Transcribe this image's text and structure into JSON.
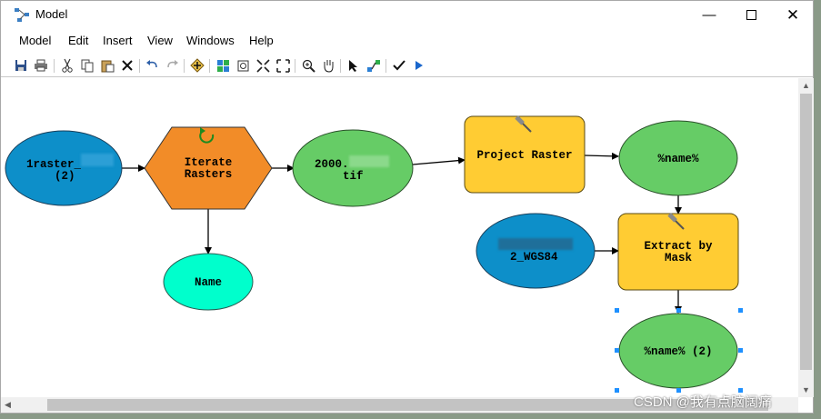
{
  "window": {
    "title": "Model"
  },
  "menu": [
    "Model",
    "Edit",
    "Insert",
    "View",
    "Windows",
    "Help"
  ],
  "toolbar_icons": [
    "save-icon",
    "print-icon",
    "cut-icon",
    "copy-icon",
    "paste-icon",
    "delete-icon",
    "undo-icon",
    "redo-icon",
    "add-data-icon",
    "auto-layout-icon",
    "full-extent-icon",
    "zoom-in-fixed-icon",
    "zoom-out-fixed-icon",
    "zoom-in-icon",
    "pan-icon",
    "select-icon",
    "connect-icon",
    "validate-icon",
    "run-icon"
  ],
  "model": {
    "input_raster": {
      "line1": "1raster_",
      "line2": "(2)"
    },
    "iterator": {
      "line1": "Iterate",
      "line2": "Rasters"
    },
    "name_var": {
      "label": "Name"
    },
    "iter_output": {
      "line1": "2000.",
      "line2": "tif"
    },
    "project_tool": {
      "label": "Project Raster"
    },
    "name_out1": {
      "label": "%name%"
    },
    "mask_input": {
      "line1": "",
      "line2": "2_WGS84"
    },
    "extract_tool": {
      "line1": "Extract by",
      "line2": "Mask"
    },
    "name_out2": {
      "label": "%name% (2)"
    }
  },
  "colors": {
    "input_data": "#0d8fc9",
    "derived_data": "#66cc66",
    "tool": "#ffcc33",
    "iterator": "#f28c28",
    "variable": "#00ffcc"
  },
  "watermark": "CSDN @我有点脑阔痛"
}
